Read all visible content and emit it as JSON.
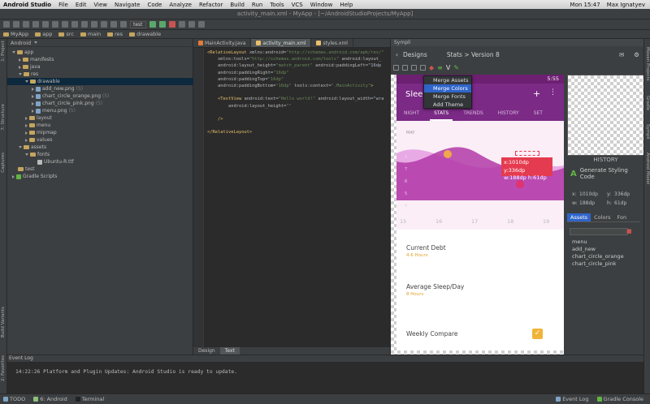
{
  "menubar": {
    "app": "Android Studio",
    "items": [
      "File",
      "Edit",
      "View",
      "Navigate",
      "Code",
      "Analyze",
      "Refactor",
      "Build",
      "Run",
      "Tools",
      "VCS",
      "Window",
      "Help"
    ],
    "time": "Mon 15:47",
    "user": "Max Ignatyev"
  },
  "window_title": "activity_main.xml - MyApp - [~/AndroidStudioProjects/MyApp]",
  "toolbar": {
    "run_config": "test"
  },
  "navbar": {
    "crumbs": [
      "MyApp",
      "app",
      "src",
      "main",
      "res",
      "drawable"
    ]
  },
  "leftstrip": {
    "project": "1: Project",
    "structure": "7: Structure",
    "captures": "Captures",
    "build_variants": "Build Variants",
    "favorites": "2: Favorites"
  },
  "project": {
    "view": "Android",
    "tree": [
      {
        "label": "app",
        "indent": 0,
        "open": true,
        "kind": "folder"
      },
      {
        "label": "manifests",
        "indent": 1,
        "open": false,
        "kind": "folder"
      },
      {
        "label": "java",
        "indent": 1,
        "open": false,
        "kind": "folder"
      },
      {
        "label": "res",
        "indent": 1,
        "open": true,
        "kind": "folder"
      },
      {
        "label": "drawable",
        "indent": 2,
        "open": true,
        "kind": "folder",
        "selected": true
      },
      {
        "label": "add_new.png",
        "indent": 3,
        "open": false,
        "kind": "png",
        "ver": "(5)"
      },
      {
        "label": "chart_circle_orange.png",
        "indent": 3,
        "open": false,
        "kind": "png",
        "ver": "(5)"
      },
      {
        "label": "chart_circle_pink.png",
        "indent": 3,
        "open": false,
        "kind": "png",
        "ver": "(5)"
      },
      {
        "label": "menu.png",
        "indent": 3,
        "open": false,
        "kind": "png",
        "ver": "(5)"
      },
      {
        "label": "layout",
        "indent": 2,
        "open": false,
        "kind": "folder"
      },
      {
        "label": "menu",
        "indent": 2,
        "open": false,
        "kind": "folder"
      },
      {
        "label": "mipmap",
        "indent": 2,
        "open": false,
        "kind": "folder"
      },
      {
        "label": "values",
        "indent": 2,
        "open": false,
        "kind": "folder"
      },
      {
        "label": "assets",
        "indent": 1,
        "open": true,
        "kind": "folder"
      },
      {
        "label": "fonts",
        "indent": 2,
        "open": true,
        "kind": "folder"
      },
      {
        "label": "Ubuntu-R.ttf",
        "indent": 3,
        "leaf": true,
        "kind": "file"
      },
      {
        "label": "test",
        "indent": 0,
        "leaf": true,
        "kind": "folder"
      },
      {
        "label": "Gradle Scripts",
        "indent": 0,
        "open": false,
        "kind": "gradle"
      }
    ]
  },
  "editor": {
    "tabs": [
      "MainActivity.java",
      "activity_main.xml",
      "styles.xml"
    ],
    "active_tab": 1,
    "lines": [
      "<RelativeLayout xmlns:android=\"http://schemas.android.com/apk/res/\"",
      "    xmlns:tools=\"http://schemas.android.com/tools\" android:layout_",
      "    android:layout_height=\"match_parent\" android:paddingLeft=\"16dp",
      "    android:paddingRight=\"16dp\"",
      "    android:paddingTop=\"16dp\"",
      "    android:paddingBottom=\"16dp\" tools:context=\".MainActivity\">",
      "",
      "    <TextView android:text=\"Hello world!\" android:layout_width=\"wra",
      "        android:layout_height=\"\"",
      "",
      "    />",
      "",
      "</RelativeLayout>"
    ],
    "design_tabs": [
      "Design",
      "Text"
    ],
    "active_design_tab": 1
  },
  "plugin": {
    "panel_title": "Sympli",
    "back_label": "Designs",
    "breadcrumb": "Stats > Version 8",
    "menu_items": [
      "Merge Assets",
      "Merge Colors",
      "Merge Fonts",
      "Add Theme"
    ],
    "menu_selected": 1,
    "tooltip_line1": "x:1010dp y:336dp",
    "tooltip_line2": "w:188dp h:61dp",
    "phone": {
      "status_time": "5:55",
      "app_title": "Sleep",
      "tabs": [
        "NIGHT",
        "STATS",
        "TRENDS",
        "HISTORY",
        "SET"
      ],
      "active_tab": 1,
      "chart_month": "MAY",
      "chart_x_labels": [
        "15",
        "16",
        "17",
        "18",
        "19"
      ],
      "chart_y_labels": [
        "8",
        "7",
        "6",
        "5",
        "4"
      ],
      "stats": [
        {
          "title": "Current Debt",
          "sub": "4.6 Hours"
        },
        {
          "title": "Average Sleep/Day",
          "sub": "8 Hours"
        },
        {
          "title": "Weekly Compare",
          "sub": ""
        }
      ]
    },
    "history_label": "HISTORY",
    "generate_label": "Generate Styling Code",
    "coords": {
      "x": "x:",
      "x_val": "1010dp",
      "y": "y:",
      "y_val": "336dp",
      "w": "w:",
      "w_val": "188dp",
      "h": "h:",
      "h_val": "61dp"
    },
    "asset_tabs": [
      "Assets",
      "Colors",
      "Fon"
    ],
    "assets": [
      "menu",
      "add_new",
      "chart_circle_orange",
      "chart_circle_pink"
    ]
  },
  "rightstrip": {
    "maven": "Maven Projects",
    "gradle": "Gradle",
    "sympli": "Sympli",
    "android_model": "Android Model"
  },
  "eventlog": {
    "title": "Event Log",
    "message": "14:22:26 Platform and Plugin Updates: Android Studio is ready to update."
  },
  "bottombar": {
    "todo": "TODO",
    "android": "6: Android",
    "terminal": "Terminal",
    "event_log": "Event Log",
    "gradle_console": "Gradle Console"
  }
}
